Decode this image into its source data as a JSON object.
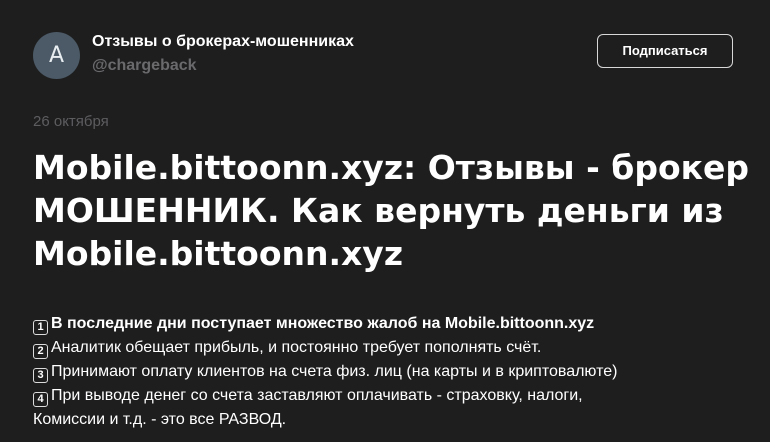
{
  "channel": {
    "avatar_letter": "A",
    "name": "Отзывы о брокерах-мошенниках",
    "handle": "@chargeback",
    "subscribe_label": "Подписаться"
  },
  "post": {
    "date": "26 октября",
    "title": "Mobile.bittoonn.xyz: Отзывы - брокер МОШЕННИК. Как вернуть деньги из Mobile.bittoonn.xyz",
    "lines": [
      {
        "num": "1",
        "text": "В последние дни поступает множество жалоб на Mobile.bittoonn.xyz"
      },
      {
        "num": "2",
        "text": "Аналитик обещает прибыль, и постоянно требует пополнять счёт."
      },
      {
        "num": "3",
        "text": "Принимают оплату клиентов на счета физ. лиц (на карты и в криптовалюте)"
      },
      {
        "num": "4",
        "text": "При выводе денег со счета заставляют оплачивать - страховку, налоги,"
      },
      {
        "num": "",
        "text": "Комиссии и т.д. - это все РАЗВОД."
      }
    ]
  }
}
